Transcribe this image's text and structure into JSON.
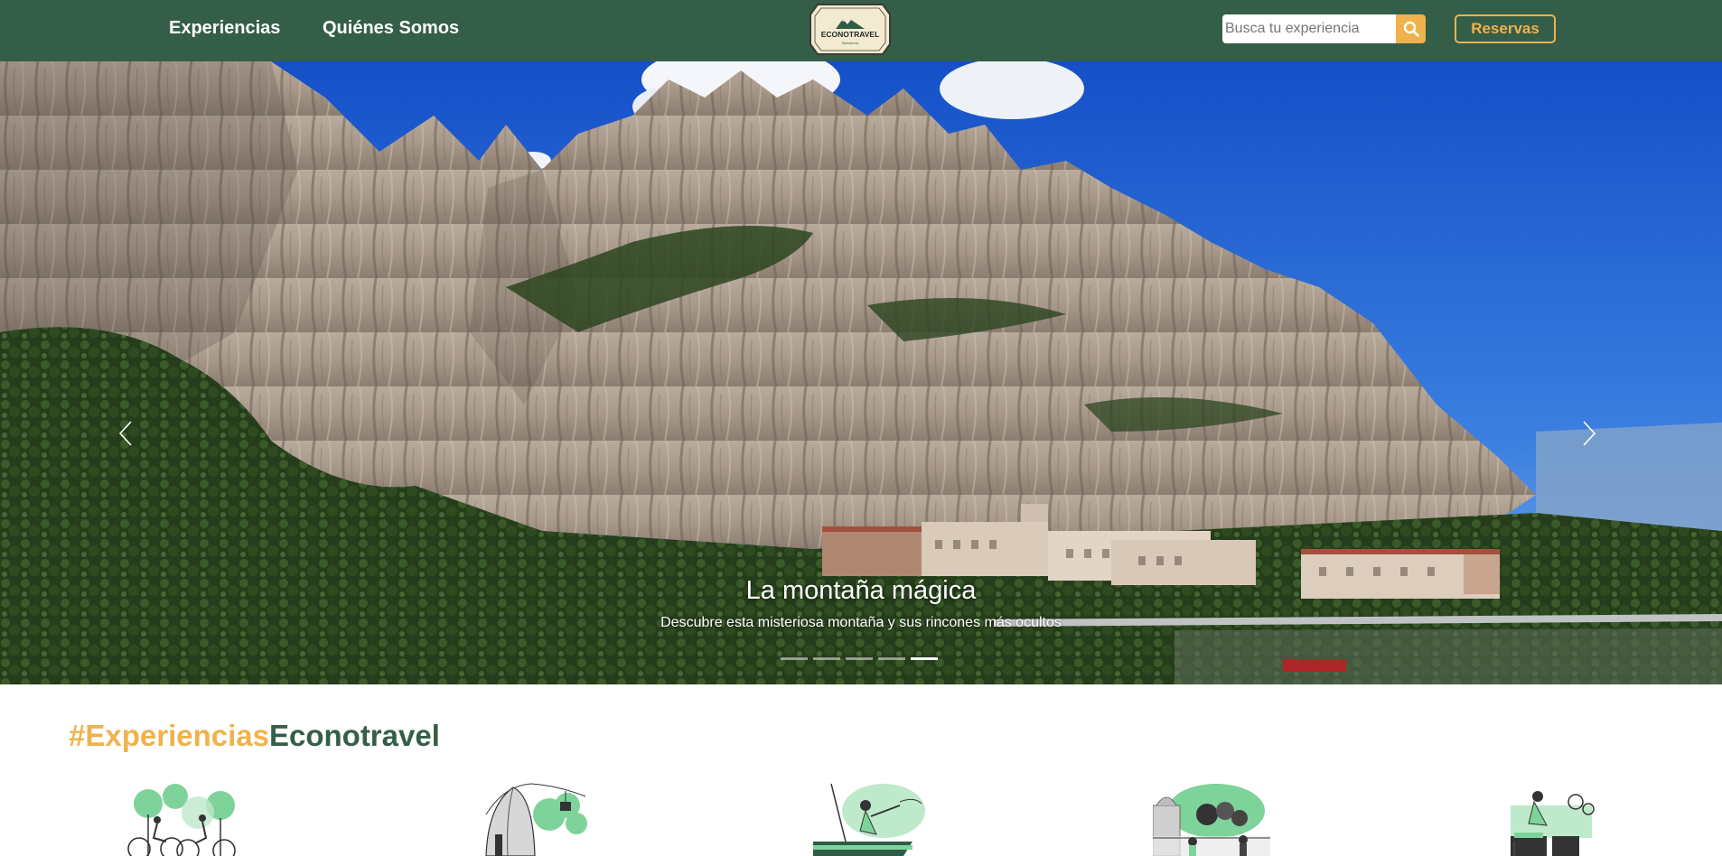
{
  "nav": {
    "experiencias": "Experiencias",
    "quienes_somos": "Quiénes Somos",
    "logo_text": "ECONOTRAVEL",
    "logo_subtext": "Barcelona",
    "search_placeholder": "Busca tu experiencia",
    "reservas": "Reservas"
  },
  "hero": {
    "title": "La montaña mágica",
    "subtitle": "Descubre esta misteriosa montaña y sus rincones más ocultos",
    "slide_count": 5,
    "active_slide": 5
  },
  "section": {
    "heading_part1": "#Experiencias",
    "heading_part2": "Econotravel"
  },
  "experiences": [
    {
      "icon": "cycling-illustration"
    },
    {
      "icon": "mountain-cablecar-illustration"
    },
    {
      "icon": "sailing-illustration"
    },
    {
      "icon": "city-tour-illustration"
    },
    {
      "icon": "cooking-illustration"
    }
  ],
  "colors": {
    "nav_green": "#355e49",
    "accent_orange": "#f0b24c",
    "illustration_green": "#7ed39a"
  }
}
